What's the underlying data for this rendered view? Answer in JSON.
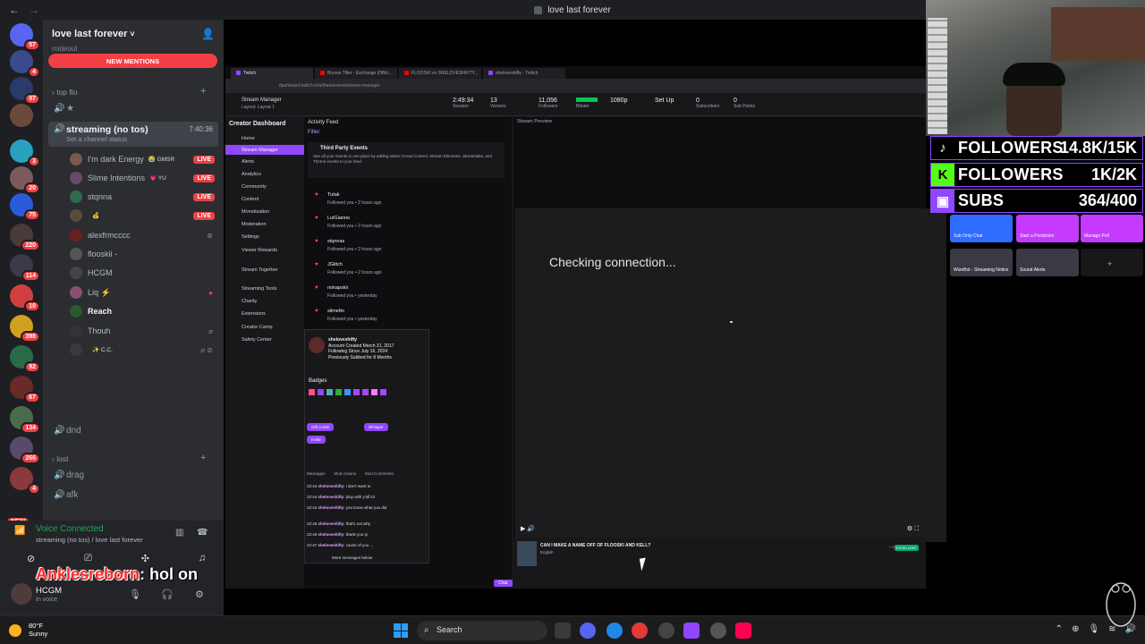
{
  "window": {
    "title": "love last forever",
    "back_glyph": "←",
    "forward_glyph": "→"
  },
  "rail_badges": [
    "57",
    "4",
    "97",
    "3",
    "20",
    "75",
    "220",
    "114",
    "10",
    "398",
    "92",
    "67",
    "134",
    "266",
    "4"
  ],
  "rail_new": "NEW",
  "server": {
    "name": "love last forever",
    "chevron": "˅",
    "partial_cat": "mideout",
    "new_mentions": "NEW MENTIONS",
    "categories": {
      "top": "top flo",
      "lost": "lost"
    },
    "star_channel": "★",
    "active_channel": {
      "name": "streaming (no tos)",
      "time": "7:40:36",
      "sub": "Set a channel status"
    },
    "members": [
      {
        "name": "I'm dark Energy",
        "tag": "😭 GMSR",
        "live": "LIVE",
        "color": "#7a5a4a"
      },
      {
        "name": "Slime Intentions",
        "tag": "💗 YU",
        "live": "LIVE",
        "color": "#6a4a6a"
      },
      {
        "name": "stqnna",
        "tag": "",
        "live": "LIVE",
        "color": "#2f6b4f"
      },
      {
        "name": "",
        "tag": "💰",
        "live": "LIVE",
        "color": "#5a4a3a"
      },
      {
        "name": "alexfrmcccc",
        "tag": "",
        "live": "",
        "color": "#6b2020"
      },
      {
        "name": "flooskii -",
        "tag": "",
        "live": "",
        "color": "#555"
      },
      {
        "name": "HCGM",
        "tag": "",
        "live": "",
        "color": "#444"
      },
      {
        "name": "Liq ⚡",
        "tag": "",
        "live": "",
        "color": "#8a5070"
      },
      {
        "name": "Reach",
        "tag": "",
        "live": "",
        "color": "#2a5a2a"
      },
      {
        "name": "Thouh",
        "tag": "",
        "live": "",
        "color": "#333"
      },
      {
        "name": "",
        "tag": "✨ C.C.",
        "live": "",
        "color": "#3a3a3a"
      }
    ],
    "other_channels": {
      "dnd": "dnd",
      "drag": "drag",
      "afk": "afk"
    }
  },
  "voice": {
    "status": "Voice Connected",
    "location": "streaming (no tos) / love last forever"
  },
  "overlay_message": {
    "user": "Anklesreborn",
    "text": ": hol on"
  },
  "user_panel": {
    "name": "HCGM",
    "status": "In voice"
  },
  "twitch": {
    "tabs": [
      "Twitch",
      "Bryson Tiller - Exchange (Offici...",
      "FLOOSKI vs SHELOVESHIFTY...",
      "sheloveshifty - Twitch"
    ],
    "url": "dashboard.twitch.tv/u/theuniverse/stream-manager",
    "header_title": "Stream Manager",
    "header_sub": "Layout: Layout 1",
    "stats": [
      {
        "value": "2:49:34",
        "label": "Session"
      },
      {
        "value": "13",
        "label": "Viewers"
      },
      {
        "value": "11,056",
        "label": "Followers"
      },
      {
        "value": "",
        "label": "Bitrate"
      },
      {
        "value": "1080p",
        "label": "Resolution"
      },
      {
        "value": "Set Up",
        "label": "Subscribers"
      },
      {
        "value": "0",
        "label": "Subscribers"
      },
      {
        "value": "0",
        "label": "Sub Points"
      }
    ],
    "sidebar_title": "Creator Dashboard",
    "sidebar": [
      "Home",
      "Stream Manager",
      "Alerts",
      "Analytics",
      "Community",
      "Content",
      "Monetization",
      "Moderation",
      "Settings",
      "Viewer Rewards",
      "Stream Together",
      "Streaming Tools",
      "Charity",
      "Extensions",
      "Creator Camp",
      "Safety Center"
    ],
    "activity_title": "Activity Feed",
    "filter": "Filter",
    "third_party": {
      "title": "Third Party Events",
      "desc": "See all your events in one place by adding select Crowd Control, Stream Elements, Streamlabs, and Throne events to your feed."
    },
    "followers": [
      {
        "name": "Tutak",
        "when": "Followed you • 2 hours ago"
      },
      {
        "name": "LulGianno",
        "when": "Followed you • 2 hours ago"
      },
      {
        "name": "stqnnas",
        "when": "Followed you • 2 hours ago"
      },
      {
        "name": "JGlitch",
        "when": "Followed you • 2 hours ago"
      },
      {
        "name": "nokapskii",
        "when": "Followed you • yesterday"
      },
      {
        "name": "slimetto",
        "when": "Followed you • yesterday"
      }
    ],
    "card": {
      "user": "sheloveshifty",
      "created": "Account Created March 31, 2017",
      "following": "Following Since July 16, 2024",
      "subbed": "Previously Subbed for 8 Months",
      "badges": "Badges",
      "gift": "Gift a Sub",
      "whisper": "Whisper",
      "invite": "Invite",
      "tabs": [
        "Messages",
        "Mod Actions",
        "Mod Comments"
      ],
      "chat": [
        {
          "t": "22:44",
          "u": "sheloveshifty",
          "m": ": i don't want to"
        },
        {
          "t": "22:44",
          "u": "sheloveshifty",
          "m": ": play with y'all lol"
        },
        {
          "t": "22:44",
          "u": "sheloveshifty",
          "m": ": you know what you did"
        },
        {
          "t": "22:45",
          "u": "sheloveshifty",
          "m": ": that's not why"
        },
        {
          "t": "22:46",
          "u": "sheloveshifty",
          "m": ": thank you ty"
        },
        {
          "t": "22:47",
          "u": "sheloveshifty",
          "m": ": cause of you ..."
        }
      ],
      "more": "More messages below."
    },
    "preview_title": "Stream Preview",
    "checking": "Checking connection...",
    "stream_title": "CAN I MAKE A NAME OFF OF FLOOSKI AND KELL?",
    "stream_lang": "English",
    "live": "• Live",
    "quality": "EXCELLENT",
    "chat_btn": "Chat"
  },
  "goals": [
    {
      "label": "FOLLOWERS",
      "value": "14.8K/15K",
      "icon": "tiktok-icon",
      "color": "#000000"
    },
    {
      "label": "FOLLOWERS",
      "value": "1K/2K",
      "icon": "kick-icon",
      "color": "#53fc18"
    },
    {
      "label": "SUBS",
      "value": "364/400",
      "icon": "twitch-icon",
      "color": "#9146ff"
    }
  ],
  "tiles": [
    {
      "label": "Sub Only Chat",
      "color": "#2f6bff"
    },
    {
      "label": "Start a Prediction",
      "color": "#c43bff"
    },
    {
      "label": "Manage Poll",
      "color": "#c43bff"
    },
    {
      "label": "WizeBot - Streaming Notice",
      "color": "#3a3a44"
    },
    {
      "label": "Sound Alerts",
      "color": "#3a3a44"
    }
  ],
  "taskbar": {
    "temp": "80°F",
    "weather": "Sunny",
    "search": "Search"
  }
}
